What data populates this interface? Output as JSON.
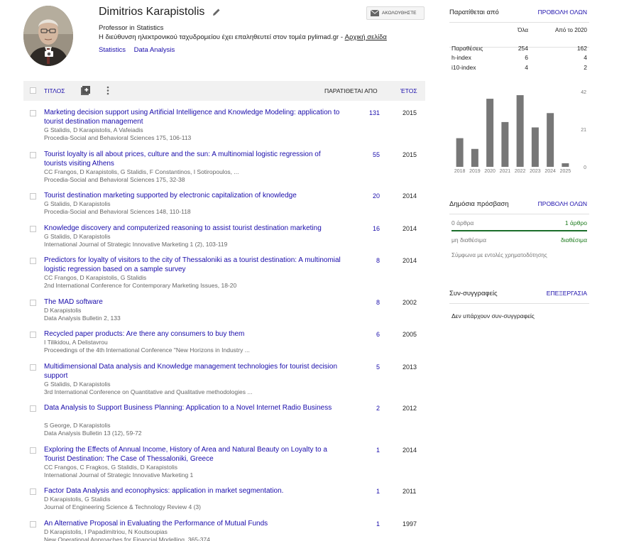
{
  "profile": {
    "name": "Dimitrios Karapistolis",
    "title": "Professor in Statistics",
    "email_text": "Η διεύθυνση ηλεκτρονικού ταχυδρομείου έχει επαληθευτεί στον τομέα pylimad.gr",
    "email_sep": " - ",
    "homepage": "Αρχική σελίδα",
    "interests": [
      "Statistics",
      "Data Analysis"
    ],
    "follow_label": "ΑΚΟΛΟΥΘΗΣΤΕ"
  },
  "table": {
    "title_col": "ΤΙΤΛΟΣ",
    "cited_col": "ΠΑΡΑΤΙΘΕΤΑΙ ΑΠΟ",
    "year_col": "ΈΤΟΣ"
  },
  "articles": [
    {
      "title": "Marketing decision support using Artificial Intelligence and Knowledge Modeling: application to tourist destination management",
      "authors": "G Stalidis, D Karapistolis, A Vafeiadis",
      "venue": "Procedia-Social and Behavioral Sciences 175, 106-113",
      "cites": "131",
      "year": "2015"
    },
    {
      "title": "Tourist loyalty is all about prices, culture and the sun: A multinomial logistic regression of tourists visiting Athens",
      "authors": "CC Frangos, D Karapistolis, G Stalidis, F Constantinos, I Sotiropoulos, ...",
      "venue": "Procedia-Social and Behavioral Sciences 175, 32-38",
      "cites": "55",
      "year": "2015"
    },
    {
      "title": "Tourist destination marketing supported by electronic capitalization of knowledge",
      "authors": "G Stalidis, D Karapistolis",
      "venue": "Procedia-Social and Behavioral Sciences 148, 110-118",
      "cites": "20",
      "year": "2014"
    },
    {
      "title": "Knowledge discovery and computerized reasoning to assist tourist destination marketing",
      "authors": "G Stalidis, D Karapistolis",
      "venue": "International Journal of Strategic Innovative Marketing 1 (2), 103-119",
      "cites": "16",
      "year": "2014"
    },
    {
      "title": "Predictors for loyalty of visitors to the city of Thessaloniki as a tourist destination: A multinomial logistic regression based on a sample survey",
      "authors": "CC Frangos, D Karapistolis, G Stalidis",
      "venue": "2nd International Conference for Contemporary Marketing Issues, 18-20",
      "cites": "8",
      "year": "2014"
    },
    {
      "title": "The MAD software",
      "authors": "D Karapistolis",
      "venue": "Data Analysis Bulletin 2, 133",
      "cites": "8",
      "year": "2002"
    },
    {
      "title": "Recycled paper products: Are there any consumers to buy them",
      "authors": "I Tilikidou, A Delistavrou",
      "venue": "Proceedings of the 4th International Conference \"New Horizons in Industry ...",
      "cites": "6",
      "year": "2005"
    },
    {
      "title": "Multidimensional Data analysis and Knowledge management technologies for tourist decision support",
      "authors": "G Stalidis, D Karapistolis",
      "venue": "3rd International Conference on Quantitative and Qualitative methodologies ...",
      "cites": "5",
      "year": "2013"
    },
    {
      "title": "Data Analysis to Support Business Planning: Application to a Novel Internet Radio Business",
      "authors": "S George, D Karapistolis",
      "venue": "Data Analysis Bulletin 13 (12), 59-72",
      "cites": "2",
      "year": "2012"
    },
    {
      "title": "Exploring the Effects of Annual Income, History of Area and Natural Beauty on Loyalty to a Tourist Destination: The Case of Thessaloniki, Greece",
      "authors": "CC Frangos, C Fragkos, G Stalidis, D Karapistolis",
      "venue": "International Journal of Strategic Innovative Marketing 1",
      "cites": "1",
      "year": "2014"
    },
    {
      "title": "Factor Data Analysis and econophysics: application in market segmentation.",
      "authors": "D Karapistolis, G Stalidis",
      "venue": "Journal of Engineering Science & Technology Review 4 (3)",
      "cites": "1",
      "year": "2011"
    },
    {
      "title": "An Alternative Proposal in Evaluating the Performance of Mutual Funds",
      "authors": "D Karapistolis, I Papadimitriou, N Koutsoupias",
      "venue": "New Operational Approaches for Financial Modelling, 365-374",
      "cites": "1",
      "year": "1997"
    }
  ],
  "cited_by": {
    "header": "Παρατίθεται από",
    "view_all": "ΠΡΟΒΟΛΗ ΟΛΩΝ",
    "col_all": "Όλα",
    "col_since": "Από το 2020",
    "metrics": [
      {
        "label": "Παραθέσεις",
        "all": "254",
        "since": "162"
      },
      {
        "label": "h-index",
        "all": "6",
        "since": "4"
      },
      {
        "label": "i10-index",
        "all": "4",
        "since": "2"
      }
    ]
  },
  "chart_data": {
    "type": "bar",
    "categories": [
      "2018",
      "2019",
      "2020",
      "2021",
      "2022",
      "2023",
      "2024",
      "2025"
    ],
    "values": [
      16,
      10,
      38,
      25,
      40,
      22,
      30,
      2
    ],
    "yticks": [
      "0",
      "21",
      "42"
    ],
    "ylim": [
      0,
      42
    ]
  },
  "public_access": {
    "header": "Δημόσια πρόσβαση",
    "view_all": "ΠΡΟΒΟΛΗ ΟΛΩΝ",
    "unavailable_count": "0 άρθρα",
    "available_count": "1 άρθρο",
    "unavailable_label": "μη διαθέσιμα",
    "available_label": "διαθέσιμα",
    "available_fraction": 1.0,
    "note": "Σύμφωνα με εντολές χρηματοδότησης"
  },
  "coauthors": {
    "header": "Συν-συγγραφείς",
    "edit": "ΕΠΕΞΕΡΓΑΣΙΑ",
    "empty": "Δεν υπάρχουν συν-συγγραφείς"
  },
  "icons": [
    "edit-icon",
    "follow-mail-icon",
    "add-icon",
    "more-icon",
    "camera-icon"
  ]
}
